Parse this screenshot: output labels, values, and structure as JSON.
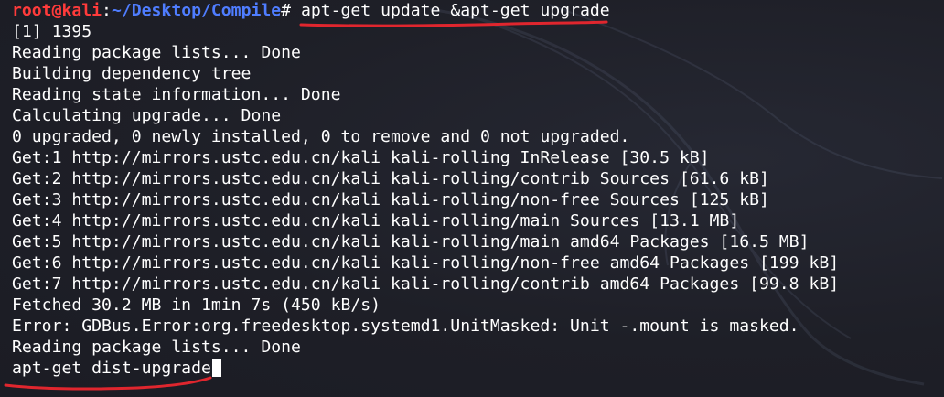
{
  "prompt": {
    "user_host": "root@kali",
    "separator": ":",
    "path": "~/Desktop/Compile",
    "symbol": "#",
    "command": " apt-get update &apt-get upgrade"
  },
  "output": [
    "[1] 1395",
    "Reading package lists... Done",
    "Building dependency tree",
    "Reading state information... Done",
    "Calculating upgrade... Done",
    "0 upgraded, 0 newly installed, 0 to remove and 0 not upgraded.",
    "Get:1 http://mirrors.ustc.edu.cn/kali kali-rolling InRelease [30.5 kB]",
    "Get:2 http://mirrors.ustc.edu.cn/kali kali-rolling/contrib Sources [61.6 kB]",
    "Get:3 http://mirrors.ustc.edu.cn/kali kali-rolling/non-free Sources [125 kB]",
    "Get:4 http://mirrors.ustc.edu.cn/kali kali-rolling/main Sources [13.1 MB]",
    "Get:5 http://mirrors.ustc.edu.cn/kali kali-rolling/main amd64 Packages [16.5 MB]",
    "Get:6 http://mirrors.ustc.edu.cn/kali kali-rolling/non-free amd64 Packages [199 kB]",
    "Get:7 http://mirrors.ustc.edu.cn/kali kali-rolling/contrib amd64 Packages [99.8 kB]",
    "Fetched 30.2 MB in 1min 7s (450 kB/s)",
    "Error: GDBus.Error:org.freedesktop.systemd1.UnitMasked: Unit -.mount is masked.",
    "Reading package lists... Done"
  ],
  "current_input": "apt-get dist-upgrade",
  "colors": {
    "background": "#1e1f27",
    "text": "#ffffff",
    "prompt_user": "#ff3b3b",
    "prompt_path": "#4f7dff",
    "annotation": "#e0262e"
  },
  "icons": {
    "watermark": "kali-dragon-icon"
  }
}
